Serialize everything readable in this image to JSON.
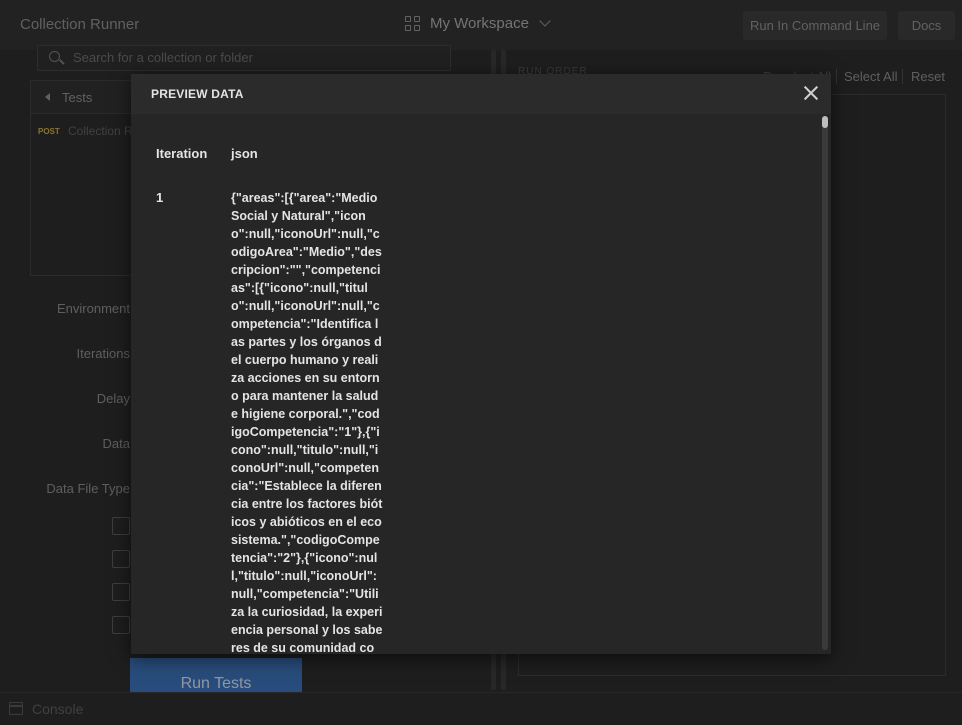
{
  "header": {
    "app_title": "Collection Runner",
    "workspace_label": "My Workspace",
    "run_cmd_label": "Run In Command Line",
    "docs_label": "Docs"
  },
  "left": {
    "search_placeholder": "Search for a collection or folder",
    "back_label": "Tests",
    "request_method": "POST",
    "request_name": "Collection R",
    "environment_label": "Environment",
    "iterations_label": "Iterations",
    "delay_label": "Delay",
    "data_label": "Data",
    "data_file_type_label": "Data File Type",
    "run_button": "Run Tests"
  },
  "right": {
    "run_order_label": "RUN ORDER",
    "deselect_all": "Deselect All",
    "select_all": "Select All",
    "reset": "Reset"
  },
  "footer": {
    "console_label": "Console"
  },
  "modal": {
    "title": "PREVIEW DATA",
    "columns": [
      "Iteration",
      "json"
    ],
    "rows": [
      {
        "iteration": "1",
        "json": "{\"areas\":[{\"area\":\"Medio Social y Natural\",\"icono\":null,\"iconoUrl\":null,\"codigoArea\":\"Medio\",\"descripcion\":\"\",\"competencias\":[{\"icono\":null,\"titulo\":null,\"iconoUrl\":null,\"competencia\":\"Identifica las partes y los órganos del cuerpo humano y realiza acciones en su entorno para mantener la salud e higiene corporal.\",\"codigoCompetencia\":\"1\"},{\"icono\":null,\"titulo\":null,\"iconoUrl\":null,\"competencia\":\"Establece la diferencia entre los factores bióticos y abióticos en el ecosistema.\",\"codigoCompetencia\":\"2\"},{\"icono\":null,\"titulo\":null,\"iconoUrl\":null,\"competencia\":\"Utiliza la curiosidad, la experiencia personal y los saberes de su comunidad como método de aprendizaje.\",\"codigoCo"
      }
    ]
  }
}
